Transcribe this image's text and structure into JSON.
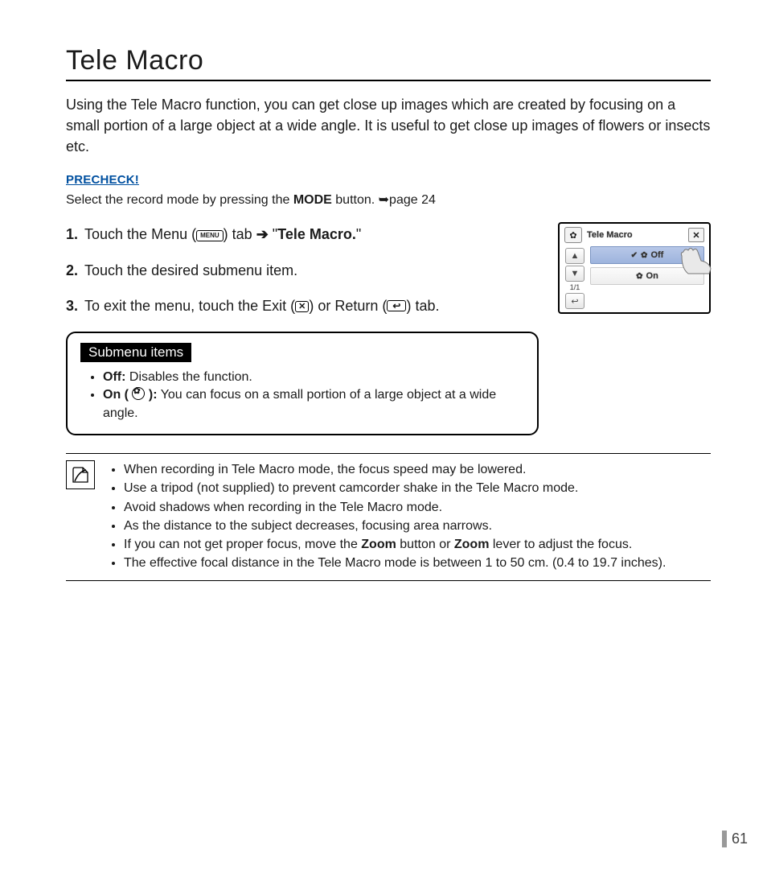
{
  "title": "Tele Macro",
  "intro": "Using the Tele Macro function, you can get close up images which are created by focusing on a small portion of a large object at a wide angle. It is useful to get close up images of flowers or insects etc.",
  "precheck_label": "PRECHECK!",
  "precheck_pre": "Select the record mode by pressing the ",
  "precheck_mode": "MODE",
  "precheck_post": " button. ➥page 24",
  "steps": [
    {
      "num": "1.",
      "pre": "Touch the Menu (",
      "badge": "MENU",
      "mid": ") tab ",
      "arrow": "➔",
      "mid2": " \"",
      "bold": "Tele Macro.",
      "post": "\""
    },
    {
      "num": "2.",
      "text": "Touch the desired submenu item."
    },
    {
      "num": "3.",
      "pre": "To exit the menu, touch the Exit (",
      "badgeX": "✕",
      "mid": ") or Return (",
      "badgeR": "↩",
      "post": ") tab."
    }
  ],
  "submenu": {
    "heading": "Submenu items",
    "off_label": "Off:",
    "off_text": " Disables the function.",
    "on_label": "On ( ",
    "on_label2": " ):",
    "on_text": " You can focus on a small portion of a large object at a wide angle."
  },
  "notes": [
    "When recording in Tele Macro mode, the focus speed may be lowered.",
    "Use a tripod (not supplied) to prevent camcorder shake in the Tele Macro mode.",
    "Avoid shadows when recording in the Tele Macro mode.",
    "As the distance to the subject decreases, focusing area narrows.",
    {
      "pre": "If you can not get proper focus, move the ",
      "b1": "Zoom",
      "mid": " button or ",
      "b2": "Zoom",
      "post": " lever to adjust the focus."
    },
    "The effective focal distance in the Tele Macro mode is between 1 to 50 cm. (0.4 to 19.7 inches)."
  ],
  "page_number": "61",
  "device": {
    "title": "Tele Macro",
    "close": "✕",
    "up": "▲",
    "down": "▼",
    "page": "1/1",
    "return": "↩",
    "row_off_check": "✔",
    "row_off": "Off",
    "row_on": "On",
    "flower": "✿"
  }
}
